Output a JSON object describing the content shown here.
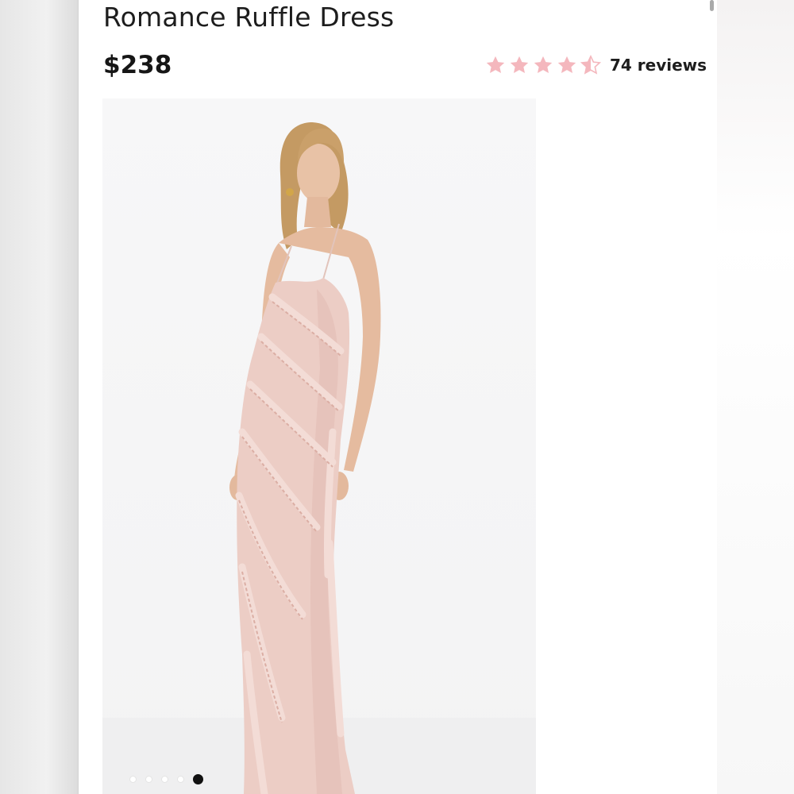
{
  "product": {
    "title": "Romance Ruffle Dress",
    "price": "$238"
  },
  "rating": {
    "value": 4.5,
    "max": 5,
    "reviews_label": "74 reviews",
    "star_color": "#f4b7bd"
  },
  "gallery": {
    "image_subject": "model in blush pink ruffle maxi dress",
    "dress_color": "#e9cbc3",
    "slide_count": 5,
    "active_slide": 5
  }
}
